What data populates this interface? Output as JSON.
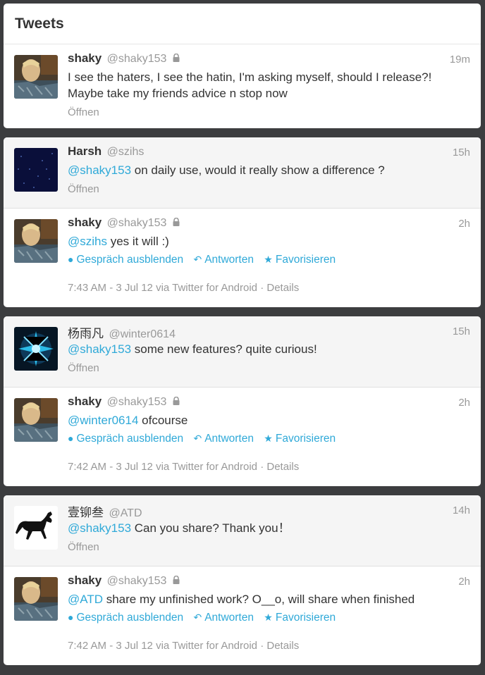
{
  "header": {
    "title": "Tweets"
  },
  "labels": {
    "open": "Öffnen",
    "hide_conversation": "Gespräch ausblenden",
    "reply": "Antworten",
    "favorite": "Favorisieren",
    "details": "Details"
  },
  "colors": {
    "link": "#2fa9d8",
    "muted": "#999999",
    "background": "#3c3d3f"
  },
  "tweets": [
    {
      "name": "shaky",
      "handle": "@shaky153",
      "time": "19m",
      "protected": true,
      "mention": "",
      "text": "I see the haters, I see the hatin, I'm asking myself, should I release?! Maybe take my friends advice n stop now"
    },
    {
      "name": "Harsh",
      "handle": "@szihs",
      "time": "15h",
      "mention": "@shaky153",
      "text": " on daily use, would it really show a difference ?"
    },
    {
      "name": "shaky",
      "handle": "@shaky153",
      "time": "2h",
      "protected": true,
      "mention": "@szihs",
      "text": " yes it will :)",
      "footer": "7:43 AM - 3 Jul 12 via Twitter for Android · "
    },
    {
      "name": "杨雨凡",
      "handle": "@winter0614",
      "time": "15h",
      "mention": "@shaky153",
      "text": " some new features? quite curious!"
    },
    {
      "name": "shaky",
      "handle": "@shaky153",
      "time": "2h",
      "protected": true,
      "mention": "@winter0614",
      "text": " ofcourse",
      "footer": "7:42 AM - 3 Jul 12 via Twitter for Android · "
    },
    {
      "name": "壹铆叁",
      "handle": "@ATD",
      "time": "14h",
      "mention": "@shaky153",
      "text": " Can you share? Thank you！"
    },
    {
      "name": "shaky",
      "handle": "@shaky153",
      "time": "2h",
      "protected": true,
      "mention": "@ATD",
      "text": " share my unfinished work? O__o, will share when finished",
      "footer": "7:42 AM - 3 Jul 12 via Twitter for Android · "
    }
  ]
}
